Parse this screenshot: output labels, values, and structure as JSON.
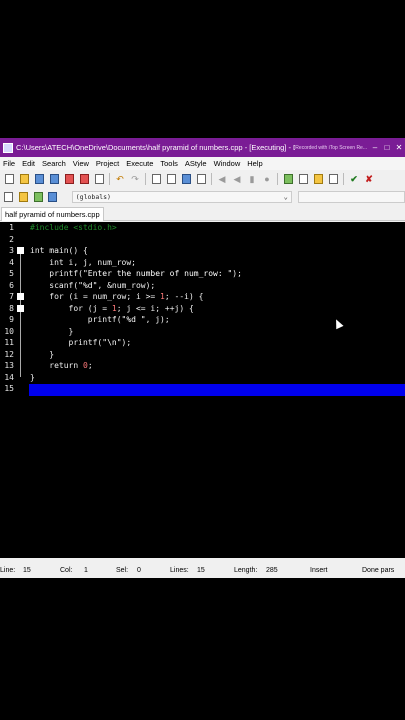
{
  "window": {
    "title": "C:\\Users\\ATECH\\OneDrive\\Documents\\half pyramid of numbers.cpp - [Executing] - De...",
    "recorder_watermark": "Recorded with iTop Screen Re..."
  },
  "menu": [
    "File",
    "Edit",
    "Search",
    "View",
    "Project",
    "Execute",
    "Tools",
    "AStyle",
    "Window",
    "Help"
  ],
  "toolbar": {
    "scope_select": "(globals)"
  },
  "tabs": [
    {
      "label": "half pyramid of numbers.cpp"
    }
  ],
  "editor": {
    "lines": [
      {
        "n": "1",
        "text": "#include <stdio.h>"
      },
      {
        "n": "2",
        "text": ""
      },
      {
        "n": "3",
        "text": "int main() {"
      },
      {
        "n": "4",
        "text": "    int i, j, num_row;"
      },
      {
        "n": "5",
        "text": "    printf(\"Enter the number of num_row: \");"
      },
      {
        "n": "6",
        "text": "    scanf(\"%d\", &num_row);"
      },
      {
        "n": "7",
        "text": "    for (i = num_row; i >= 1; --i) {"
      },
      {
        "n": "8",
        "text": "        for (j = 1; j <= i; ++j) {"
      },
      {
        "n": "9",
        "text": "            printf(\"%d \", j);"
      },
      {
        "n": "10",
        "text": "        }"
      },
      {
        "n": "11",
        "text": "        printf(\"\\n\");"
      },
      {
        "n": "12",
        "text": "    }"
      },
      {
        "n": "13",
        "text": "    return 0;"
      },
      {
        "n": "14",
        "text": "}"
      },
      {
        "n": "15",
        "text": ""
      }
    ],
    "selected_line": 15
  },
  "status": {
    "line_label": "Line:",
    "line_value": "15",
    "col_label": "Col:",
    "col_value": "1",
    "sel_label": "Sel:",
    "sel_value": "0",
    "lines_label": "Lines:",
    "lines_value": "15",
    "length_label": "Length:",
    "length_value": "285",
    "mode": "Insert",
    "parse": "Done pars"
  },
  "colors": {
    "titlebar": "#7a1c95",
    "editor_bg": "#000000",
    "selection": "#0000ee",
    "preprocessor": "#1f8c2a",
    "number": "#ff7a7a"
  }
}
